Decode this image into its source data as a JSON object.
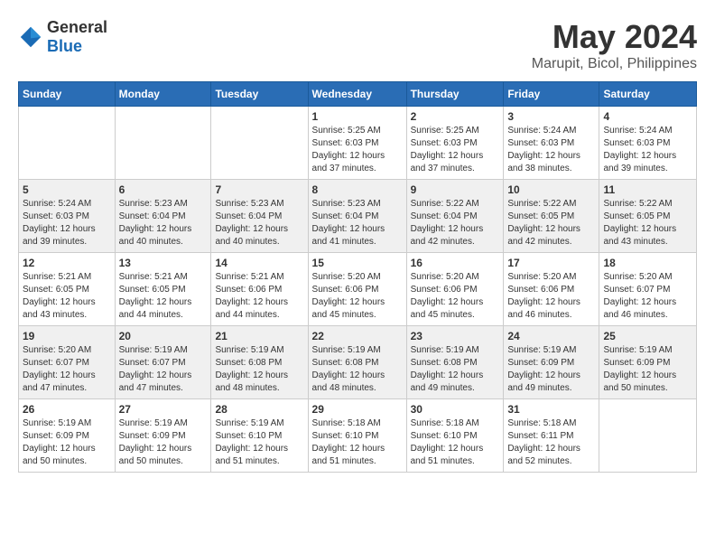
{
  "header": {
    "logo_general": "General",
    "logo_blue": "Blue",
    "title": "May 2024",
    "subtitle": "Marupit, Bicol, Philippines"
  },
  "days_of_week": [
    "Sunday",
    "Monday",
    "Tuesday",
    "Wednesday",
    "Thursday",
    "Friday",
    "Saturday"
  ],
  "weeks": [
    [
      {
        "day": "",
        "info": ""
      },
      {
        "day": "",
        "info": ""
      },
      {
        "day": "",
        "info": ""
      },
      {
        "day": "1",
        "info": "Sunrise: 5:25 AM\nSunset: 6:03 PM\nDaylight: 12 hours\nand 37 minutes."
      },
      {
        "day": "2",
        "info": "Sunrise: 5:25 AM\nSunset: 6:03 PM\nDaylight: 12 hours\nand 37 minutes."
      },
      {
        "day": "3",
        "info": "Sunrise: 5:24 AM\nSunset: 6:03 PM\nDaylight: 12 hours\nand 38 minutes."
      },
      {
        "day": "4",
        "info": "Sunrise: 5:24 AM\nSunset: 6:03 PM\nDaylight: 12 hours\nand 39 minutes."
      }
    ],
    [
      {
        "day": "5",
        "info": "Sunrise: 5:24 AM\nSunset: 6:03 PM\nDaylight: 12 hours\nand 39 minutes."
      },
      {
        "day": "6",
        "info": "Sunrise: 5:23 AM\nSunset: 6:04 PM\nDaylight: 12 hours\nand 40 minutes."
      },
      {
        "day": "7",
        "info": "Sunrise: 5:23 AM\nSunset: 6:04 PM\nDaylight: 12 hours\nand 40 minutes."
      },
      {
        "day": "8",
        "info": "Sunrise: 5:23 AM\nSunset: 6:04 PM\nDaylight: 12 hours\nand 41 minutes."
      },
      {
        "day": "9",
        "info": "Sunrise: 5:22 AM\nSunset: 6:04 PM\nDaylight: 12 hours\nand 42 minutes."
      },
      {
        "day": "10",
        "info": "Sunrise: 5:22 AM\nSunset: 6:05 PM\nDaylight: 12 hours\nand 42 minutes."
      },
      {
        "day": "11",
        "info": "Sunrise: 5:22 AM\nSunset: 6:05 PM\nDaylight: 12 hours\nand 43 minutes."
      }
    ],
    [
      {
        "day": "12",
        "info": "Sunrise: 5:21 AM\nSunset: 6:05 PM\nDaylight: 12 hours\nand 43 minutes."
      },
      {
        "day": "13",
        "info": "Sunrise: 5:21 AM\nSunset: 6:05 PM\nDaylight: 12 hours\nand 44 minutes."
      },
      {
        "day": "14",
        "info": "Sunrise: 5:21 AM\nSunset: 6:06 PM\nDaylight: 12 hours\nand 44 minutes."
      },
      {
        "day": "15",
        "info": "Sunrise: 5:20 AM\nSunset: 6:06 PM\nDaylight: 12 hours\nand 45 minutes."
      },
      {
        "day": "16",
        "info": "Sunrise: 5:20 AM\nSunset: 6:06 PM\nDaylight: 12 hours\nand 45 minutes."
      },
      {
        "day": "17",
        "info": "Sunrise: 5:20 AM\nSunset: 6:06 PM\nDaylight: 12 hours\nand 46 minutes."
      },
      {
        "day": "18",
        "info": "Sunrise: 5:20 AM\nSunset: 6:07 PM\nDaylight: 12 hours\nand 46 minutes."
      }
    ],
    [
      {
        "day": "19",
        "info": "Sunrise: 5:20 AM\nSunset: 6:07 PM\nDaylight: 12 hours\nand 47 minutes."
      },
      {
        "day": "20",
        "info": "Sunrise: 5:19 AM\nSunset: 6:07 PM\nDaylight: 12 hours\nand 47 minutes."
      },
      {
        "day": "21",
        "info": "Sunrise: 5:19 AM\nSunset: 6:08 PM\nDaylight: 12 hours\nand 48 minutes."
      },
      {
        "day": "22",
        "info": "Sunrise: 5:19 AM\nSunset: 6:08 PM\nDaylight: 12 hours\nand 48 minutes."
      },
      {
        "day": "23",
        "info": "Sunrise: 5:19 AM\nSunset: 6:08 PM\nDaylight: 12 hours\nand 49 minutes."
      },
      {
        "day": "24",
        "info": "Sunrise: 5:19 AM\nSunset: 6:09 PM\nDaylight: 12 hours\nand 49 minutes."
      },
      {
        "day": "25",
        "info": "Sunrise: 5:19 AM\nSunset: 6:09 PM\nDaylight: 12 hours\nand 50 minutes."
      }
    ],
    [
      {
        "day": "26",
        "info": "Sunrise: 5:19 AM\nSunset: 6:09 PM\nDaylight: 12 hours\nand 50 minutes."
      },
      {
        "day": "27",
        "info": "Sunrise: 5:19 AM\nSunset: 6:09 PM\nDaylight: 12 hours\nand 50 minutes."
      },
      {
        "day": "28",
        "info": "Sunrise: 5:19 AM\nSunset: 6:10 PM\nDaylight: 12 hours\nand 51 minutes."
      },
      {
        "day": "29",
        "info": "Sunrise: 5:18 AM\nSunset: 6:10 PM\nDaylight: 12 hours\nand 51 minutes."
      },
      {
        "day": "30",
        "info": "Sunrise: 5:18 AM\nSunset: 6:10 PM\nDaylight: 12 hours\nand 51 minutes."
      },
      {
        "day": "31",
        "info": "Sunrise: 5:18 AM\nSunset: 6:11 PM\nDaylight: 12 hours\nand 52 minutes."
      },
      {
        "day": "",
        "info": ""
      }
    ]
  ]
}
